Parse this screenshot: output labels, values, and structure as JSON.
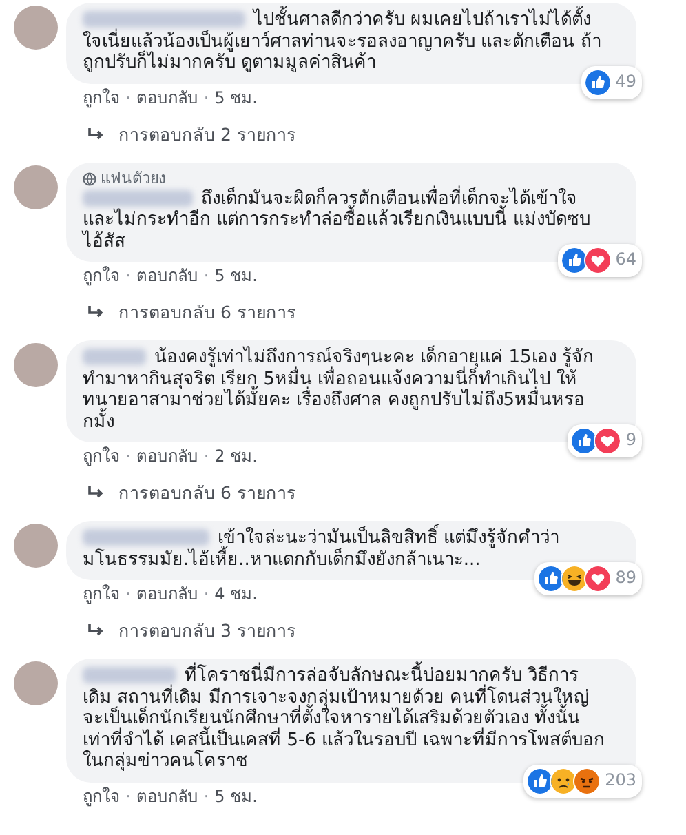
{
  "comments": [
    {
      "text": "ไปชั้นศาลดีกว่าครับ ผมเคยไปถ้าเราไม่ได้ตั้งใจเนี่ยแล้วน้องเป็นผู้เยาว์ศาลท่านจะรอลงอาญาครับ และตักเตือน ถ้าถูกปรับก็ไม่มากครับ ดูตามมูลค่าสินค้า",
      "reactions": [
        {
          "kind": "like"
        }
      ],
      "count": "49",
      "like": "ถูกใจ",
      "dot_1": "·",
      "reply": "ตอบกลับ",
      "dot_2": "·",
      "time": "5 ชม.",
      "replies": "การตอบกลับ 2 รายการ"
    },
    {
      "badge": "แฟนตัวยง",
      "text": "ถึงเด็กมันจะผิดก็ควรตักเตือนเพื่อที่เด็กจะได้เข้าใจ และไม่กระทำอีก แต่การกระทำล่อซื้อแล้วเรียกเงินแบบนี้ แม่งบัดซบไอ้สัส",
      "reactions": [
        {
          "kind": "like"
        },
        {
          "kind": "love"
        }
      ],
      "count": "64",
      "like": "ถูกใจ",
      "dot_1": "·",
      "reply": "ตอบกลับ",
      "dot_2": "·",
      "time": "5 ชม.",
      "replies": "การตอบกลับ 6 รายการ"
    },
    {
      "text": "น้องคงรู้เท่าไม่ถึงการณ์จริงๆนะคะ เด็กอายุแค่ 15เอง รู้จักทำมาหากินสุจริต เรียก 5หมื่น เพื่อถอนแจ้งความนี่ก็ทำเกินไป ให้ทนายอาสามาช่วยได้มั้ยคะ เรื่องถึงศาล คงถูกปรับไม่ถึง5หมื่นหรอกมั้ง",
      "reactions": [
        {
          "kind": "like"
        },
        {
          "kind": "love"
        }
      ],
      "count": "9",
      "like": "ถูกใจ",
      "dot_1": "·",
      "reply": "ตอบกลับ",
      "dot_2": "·",
      "time": "2 ชม.",
      "replies": "การตอบกลับ 6 รายการ"
    },
    {
      "text": "เข้าใจล่ะนะว่ามันเป็นลิขสิทธิ์ แต่มึงรู้จักคำว่ามโนธรรมมัย.ไอ้เหี้ย..หาแดกกับเด็กมึงยังกล้าเนาะ...",
      "reactions": [
        {
          "kind": "like"
        },
        {
          "kind": "haha"
        },
        {
          "kind": "love"
        }
      ],
      "count": "89",
      "like": "ถูกใจ",
      "dot_1": "·",
      "reply": "ตอบกลับ",
      "dot_2": "·",
      "time": "4 ชม.",
      "replies": "การตอบกลับ 3 รายการ"
    },
    {
      "text": "ที่โคราชนี่มีการล่อจับลักษณะนี้บ่อยมากครับ วิธีการเดิม สถานที่เดิม มีการเจาะจงกลุ่มเป้าหมายด้วย คนที่โดนส่วนใหญ่จะเป็นเด็กนักเรียนนักศึกษาที่ตั้งใจหารายได้เสริมด้วยตัวเอง ทั้งนั้น เท่าที่จำได้ เคสนี้เป็นเคสที่ 5-6 แล้วในรอบปี เฉพาะที่มีการโพสต์บอกในกลุ่มข่าวคนโคราช",
      "reactions": [
        {
          "kind": "like"
        },
        {
          "kind": "sad"
        },
        {
          "kind": "angry"
        }
      ],
      "count": "203",
      "like": "ถูกใจ",
      "dot_1": "·",
      "reply": "ตอบกลับ",
      "dot_2": "·",
      "time": "5 ชม."
    }
  ]
}
